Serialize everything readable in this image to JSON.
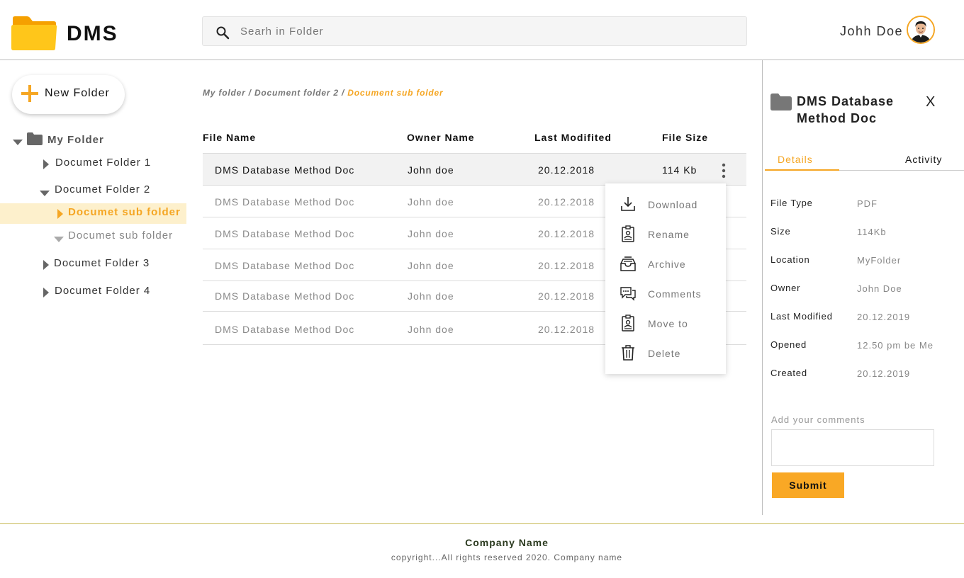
{
  "app": {
    "name": "DMS",
    "logo_icon": "folder-icon",
    "accent": "#f5a623"
  },
  "search": {
    "placeholder": "Searh in Folder",
    "icon": "search-icon"
  },
  "user": {
    "name": "Johh Doe",
    "avatar_icon": "avatar-icon"
  },
  "sidebar": {
    "new_folder_label": "New Folder",
    "root": {
      "label": "My Folder",
      "icon": "folder-icon"
    },
    "items": [
      {
        "label": "Documet Folder 1",
        "state": "collapsed"
      },
      {
        "label": "Documet Folder 2",
        "state": "expanded"
      },
      {
        "label": "Documet sub folder",
        "state": "selected"
      },
      {
        "label": "Documet sub folder",
        "state": "expanded"
      },
      {
        "label": "Documet Folder 3",
        "state": "collapsed"
      },
      {
        "label": "Documet Folder 4",
        "state": "collapsed"
      }
    ]
  },
  "breadcrumb": {
    "path": "My folder / Document folder 2 /",
    "current": "Document sub folder"
  },
  "table": {
    "columns": [
      "File Name",
      "Owner Name",
      "Last Modifited",
      "File Size"
    ],
    "rows": [
      {
        "name": "DMS Database Method Doc",
        "owner": "John doe",
        "modified": "20.12.2018",
        "size": "114 Kb",
        "active": true
      },
      {
        "name": "DMS Database Method Doc",
        "owner": "John doe",
        "modified": "20.12.2018",
        "size": ""
      },
      {
        "name": "DMS Database Method Doc",
        "owner": "John doe",
        "modified": "20.12.2018",
        "size": ""
      },
      {
        "name": "DMS Database Method Doc",
        "owner": "John doe",
        "modified": "20.12.2018",
        "size": ""
      },
      {
        "name": "DMS Database Method Doc",
        "owner": "John doe",
        "modified": "20.12.2018",
        "size": ""
      },
      {
        "name": "DMS Database Method Doc",
        "owner": "John doe",
        "modified": "20.12.2018",
        "size": ""
      }
    ]
  },
  "context_menu": {
    "items": [
      {
        "label": "Download",
        "icon": "download-icon"
      },
      {
        "label": "Rename",
        "icon": "rename-icon"
      },
      {
        "label": "Archive",
        "icon": "archive-icon"
      },
      {
        "label": "Comments",
        "icon": "comments-icon"
      },
      {
        "label": "Move to",
        "icon": "move-to-icon"
      },
      {
        "label": "Delete",
        "icon": "delete-icon"
      }
    ]
  },
  "details_panel": {
    "title": "DMS Database Method Doc",
    "close_label": "X",
    "tabs": [
      "Details",
      "Activity"
    ],
    "fields": [
      {
        "label": "File Type",
        "value": "PDF"
      },
      {
        "label": "Size",
        "value": "114Kb"
      },
      {
        "label": "Location",
        "value": "MyFolder"
      },
      {
        "label": "Owner",
        "value": "John Doe"
      },
      {
        "label": "Last Modified",
        "value": "20.12.2019"
      },
      {
        "label": "Opened",
        "value": "12.50 pm be Me"
      },
      {
        "label": "Created",
        "value": "20.12.2019"
      }
    ],
    "comments_label": "Add your comments",
    "submit_label": "Submit"
  },
  "footer": {
    "company": "Company Name",
    "copyright": "copyright...All rights reserved 2020. Company name"
  }
}
